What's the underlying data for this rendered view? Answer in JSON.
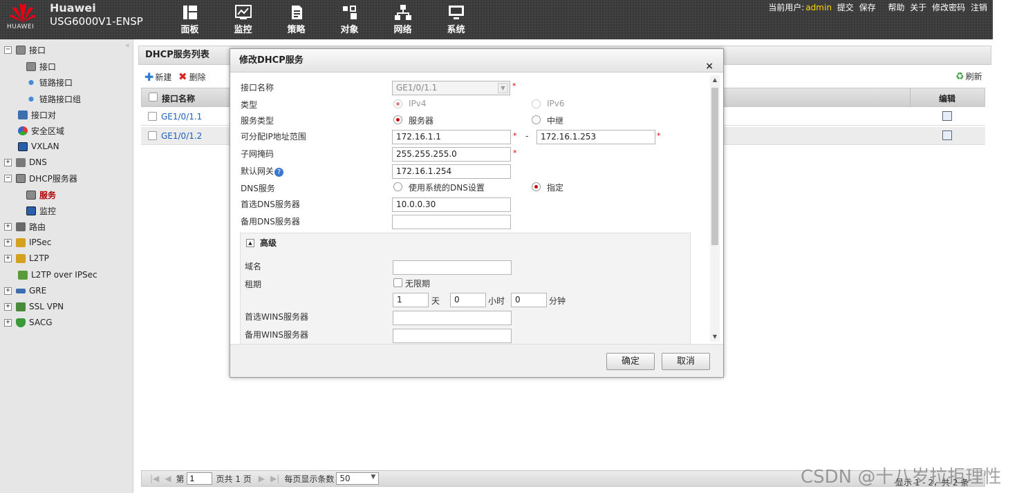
{
  "header": {
    "brand_name": "Huawei",
    "brand_model": "USG6000V1-ENSP",
    "logo_text": "HUAWEI",
    "nav": [
      {
        "label": "面板",
        "icon": "dashboard-icon"
      },
      {
        "label": "监控",
        "icon": "monitor-chart-icon"
      },
      {
        "label": "策略",
        "icon": "policy-document-icon"
      },
      {
        "label": "对象",
        "icon": "object-icon"
      },
      {
        "label": "网络",
        "icon": "network-icon"
      },
      {
        "label": "系统",
        "icon": "system-screen-icon"
      }
    ],
    "current_user_label": "当前用户:",
    "current_user": "admin",
    "links": [
      "提交",
      "保存",
      "帮助",
      "关于",
      "修改密码",
      "注销"
    ]
  },
  "sidebar": {
    "items": [
      {
        "label": "接口",
        "icon": "interface-icon",
        "expander": "−"
      },
      {
        "label": "接口",
        "icon": "interface-icon"
      },
      {
        "label": "链路接口",
        "icon": "link-icon"
      },
      {
        "label": "链路接口组",
        "icon": "link-group-icon"
      },
      {
        "label": "接口对",
        "icon": "interface-pair-icon"
      },
      {
        "label": "安全区域",
        "icon": "security-zone-icon"
      },
      {
        "label": "VXLAN",
        "icon": "vxlan-icon"
      },
      {
        "label": "DNS",
        "icon": "dns-icon",
        "expander": "+"
      },
      {
        "label": "DHCP服务器",
        "icon": "dhcp-icon",
        "expander": "−"
      },
      {
        "label": "服务",
        "icon": "service-icon"
      },
      {
        "label": "监控",
        "icon": "monitor-icon"
      },
      {
        "label": "路由",
        "icon": "route-icon",
        "expander": "+"
      },
      {
        "label": "IPSec",
        "icon": "ipsec-icon",
        "expander": "+"
      },
      {
        "label": "L2TP",
        "icon": "l2tp-icon",
        "expander": "+"
      },
      {
        "label": "L2TP over IPSec",
        "icon": "l2tp-ipsec-icon"
      },
      {
        "label": "GRE",
        "icon": "gre-icon",
        "expander": "+"
      },
      {
        "label": "SSL VPN",
        "icon": "sslvpn-icon",
        "expander": "+"
      },
      {
        "label": "SACG",
        "icon": "sacg-icon",
        "expander": "+"
      }
    ]
  },
  "main": {
    "title": "DHCP服务列表",
    "toolbar": {
      "new": "新建",
      "delete": "删除",
      "refresh": "刷新"
    },
    "columns": {
      "name": "接口名称",
      "edit": "编辑"
    },
    "rows": [
      "GE1/0/1.1",
      "GE1/0/1.2"
    ],
    "pager": {
      "page_prefix": "第",
      "page_value": "1",
      "page_suffix": "页共 1 页",
      "per_page_label": "每页显示条数",
      "per_page_value": "50",
      "summary": "显示 1 - 2，共 2 条"
    }
  },
  "modal": {
    "title": "修改DHCP服务",
    "close": "×",
    "labels": {
      "interface": "接口名称",
      "type": "类型",
      "service_type": "服务类型",
      "ip_range": "可分配IP地址范围",
      "subnet": "子网掩码",
      "gateway": "默认网关",
      "dns_service": "DNS服务",
      "dns_primary": "首选DNS服务器",
      "dns_secondary": "备用DNS服务器",
      "advanced": "高级",
      "domain": "域名",
      "lease": "租期",
      "unlimited": "无限期",
      "day": "天",
      "hour": "小时",
      "minute": "分钟",
      "wins_primary": "首选WINS服务器",
      "wins_secondary": "备用WINS服务器"
    },
    "values": {
      "interface": "GE1/0/1.1",
      "ip_start": "172.16.1.1",
      "range_sep": "-",
      "ip_end": "172.16.1.253",
      "subnet": "255.255.255.0",
      "gateway": "172.16.1.254",
      "dns_primary": "10.0.0.30",
      "dns_secondary": "",
      "domain": "",
      "lease_day": "1",
      "lease_hour": "0",
      "lease_minute": "0",
      "wins_primary": "",
      "wins_secondary": ""
    },
    "options": {
      "ipv4": "IPv4",
      "ipv6": "IPv6",
      "server": "服务器",
      "relay": "中继",
      "system_dns": "使用系统的DNS设置",
      "specify": "指定"
    },
    "buttons": {
      "ok": "确定",
      "cancel": "取消"
    }
  },
  "watermark": "CSDN @十八岁拉拒理性",
  "colors": {
    "accent_red": "#c00000",
    "link_blue": "#1a5dbb",
    "user_yellow": "#ffd700"
  }
}
